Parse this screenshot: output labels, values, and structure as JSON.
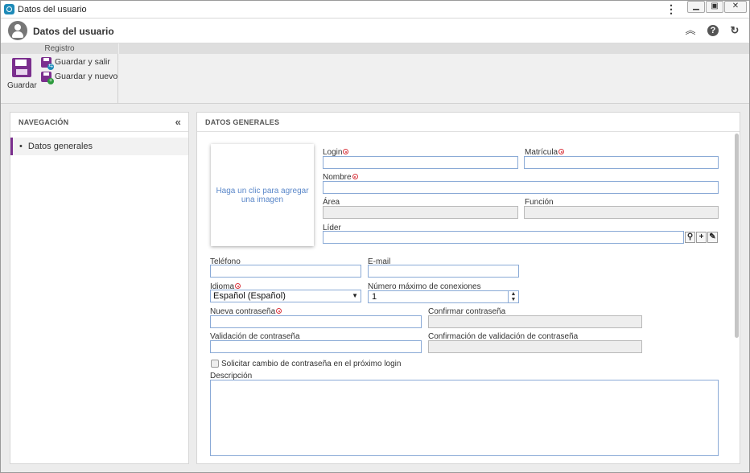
{
  "window": {
    "title": "Datos del usuario",
    "menu_icon": "kebab-icon",
    "controls": [
      "minimize-icon",
      "restore-icon",
      "close-icon"
    ]
  },
  "header": {
    "title": "Datos del usuario",
    "icons": [
      "collapse-up-icon",
      "help-icon",
      "refresh-icon"
    ]
  },
  "ribbon": {
    "group_label": "Registro",
    "save_label": "Guardar",
    "save_exit_label": "Guardar y salir",
    "save_new_label": "Guardar y nuevo"
  },
  "nav": {
    "title": "NAVEGACIÓN",
    "items": [
      {
        "label": "Datos generales",
        "bullet": "•"
      }
    ]
  },
  "main": {
    "title": "DATOS GENERALES",
    "photo_text": "Haga un clic para agregar una imagen",
    "fields": {
      "login": {
        "label": "Login",
        "value": ""
      },
      "matricula": {
        "label": "Matrícula",
        "value": ""
      },
      "nombre": {
        "label": "Nombre",
        "value": ""
      },
      "area": {
        "label": "Área",
        "value": ""
      },
      "funcion": {
        "label": "Función",
        "value": ""
      },
      "lider": {
        "label": "Líder",
        "value": ""
      },
      "telefono": {
        "label": "Teléfono",
        "value": ""
      },
      "email": {
        "label": "E-mail",
        "value": ""
      },
      "idioma": {
        "label": "Idioma",
        "value": "Español (Español)"
      },
      "max_conexiones": {
        "label": "Número máximo de conexiones",
        "value": "1"
      },
      "nueva_contrasena": {
        "label": "Nueva contraseña",
        "value": ""
      },
      "confirmar_contrasena": {
        "label": "Confirmar contraseña",
        "value": ""
      },
      "validacion": {
        "label": "Validación de contraseña",
        "value": ""
      },
      "confirmacion_validacion": {
        "label": "Confirmación de validación de contraseña",
        "value": ""
      },
      "descripcion": {
        "label": "Descripción",
        "value": ""
      }
    },
    "checkbox_label": "Solicitar cambio de contraseña en el próximo login",
    "checkbox_checked": false
  },
  "colors": {
    "accent": "#7b2f8e",
    "required": "#d9363e",
    "link": "#5a87c9",
    "input_border": "#8aaad6"
  }
}
